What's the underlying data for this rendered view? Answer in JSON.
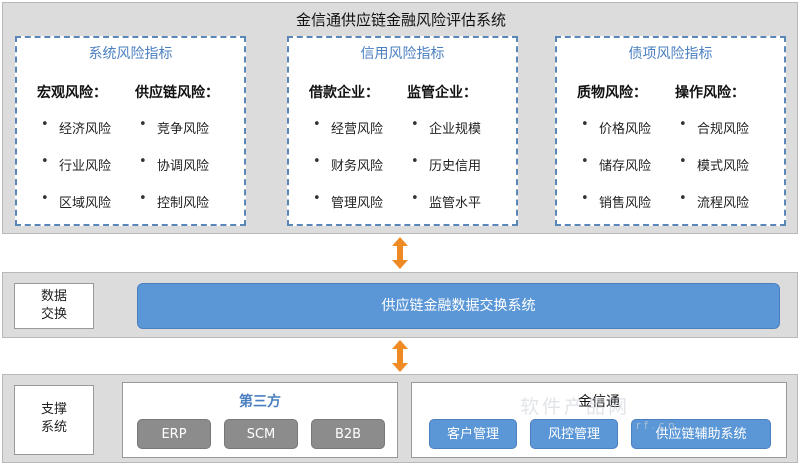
{
  "title": "金信通供应链金融风险评估系统",
  "panels": [
    {
      "title": "系统风险指标",
      "columns": [
        {
          "heading": "宏观风险：",
          "items": [
            "经济风险",
            "行业风险",
            "区域风险"
          ]
        },
        {
          "heading": "供应链风险：",
          "items": [
            "竞争风险",
            "协调风险",
            "控制风险"
          ]
        }
      ]
    },
    {
      "title": "信用风险指标",
      "columns": [
        {
          "heading": "借款企业：",
          "items": [
            "经营风险",
            "财务风险",
            "管理风险"
          ]
        },
        {
          "heading": "监管企业：",
          "items": [
            "企业规模",
            "历史信用",
            "监管水平"
          ]
        }
      ]
    },
    {
      "title": "债项风险指标",
      "columns": [
        {
          "heading": "质物风险：",
          "items": [
            "价格风险",
            "储存风险",
            "销售风险"
          ]
        },
        {
          "heading": "操作风险：",
          "items": [
            "合规风险",
            "模式风险",
            "流程风险"
          ]
        }
      ]
    }
  ],
  "exchange": {
    "label_line1": "数据",
    "label_line2": "交换",
    "bar": "供应链金融数据交换系统"
  },
  "support": {
    "label_line1": "支撑",
    "label_line2": "系统",
    "third_party": {
      "title": "第三方",
      "items": [
        "ERP",
        "SCM",
        "B2B"
      ]
    },
    "jinxintong": {
      "title": "金信通",
      "items": [
        "客户管理",
        "风控管理",
        "供应链辅助系统"
      ]
    }
  },
  "watermark": {
    "main": "软件产品网",
    "sub": "r f . c n"
  },
  "colors": {
    "accent_blue": "#5b97d6",
    "panel_border": "#5b86b8",
    "arrow_orange": "#f08a24",
    "chip_grey": "#8c8c8c",
    "band_grey": "#dcdcdc"
  }
}
